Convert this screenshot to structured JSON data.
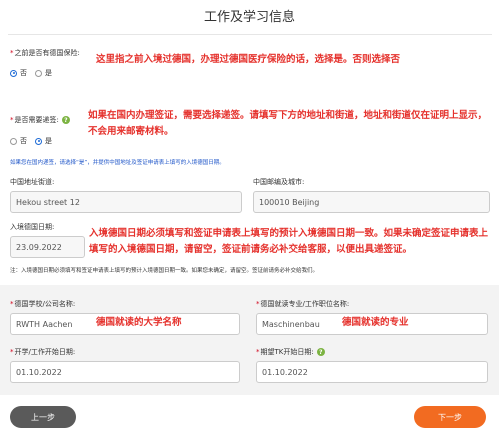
{
  "page": {
    "title": "工作及学习信息"
  },
  "insurance": {
    "label": "之前是否有德国保险:",
    "options": [
      "否",
      "是"
    ],
    "selected": 0,
    "annotation": "这里指之前入境过德国，办理过德国医疗保险的话，选择是。否则选择否"
  },
  "visa": {
    "label": "是否需要递签:",
    "options": [
      "否",
      "是"
    ],
    "selected": 1,
    "annotation": "如果在国内办理签证，需要选择递签。请填写下方的地址和街道，地址和街道仅在证明上显示，不会用来邮寄材料。",
    "note": "如果您在国内递签，请选择“是”，并提供中国地址及签证申请表上填写的入境德国日期。"
  },
  "address": {
    "street_label": "中国地址街道:",
    "street_value": "Hekou street 12",
    "city_label": "中国邮编及城市:",
    "city_value": "100010 Beijing"
  },
  "entry": {
    "label": "入境德国日期:",
    "value": "23.09.2022",
    "annotation": "入境德国日期必须填写和签证申请表上填写的预计入境德国日期一致。如果未确定签证申请表上填写的入境德国日期，请留空，签证前请务必补交给客服，以便出具递签证。",
    "note": "注：入境德国日期必须填写和签证申请表上填写的预计入境德国日期一致。如果您未确定，请留空。签证前请务必补交给我们。"
  },
  "study": {
    "school_label": "德国学校/公司名称:",
    "school_value": "RWTH Aachen",
    "school_annotation": "德国就读的大学名称",
    "major_label": "德国就读专业/工作职位名称:",
    "major_value": "Maschinenbau",
    "major_annotation": "德国就读的专业",
    "start_label": "开学/工作开始日期:",
    "start_value": "01.10.2022",
    "tk_label": "期望TK开始日期:",
    "tk_value": "01.10.2022"
  },
  "nav": {
    "prev": "上一步",
    "next": "下一步"
  },
  "colors": {
    "annotation": "#e5322d",
    "primary": "#f26b21",
    "secondary": "#5a5a5a",
    "link": "#1e55c8"
  }
}
